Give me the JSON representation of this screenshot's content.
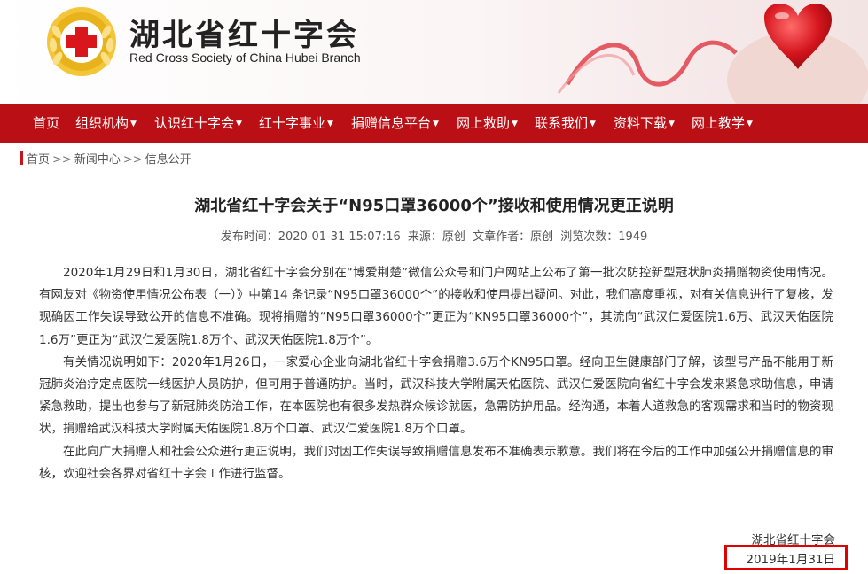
{
  "header": {
    "org_name_cn": "湖北省红十字会",
    "org_name_en": "Red Cross Society of China Hubei Branch",
    "colors": {
      "brand_red": "#b90f15",
      "emblem_gold": "#e8b21a",
      "cross_red": "#d9161c"
    }
  },
  "nav": {
    "items": [
      {
        "label": "首页",
        "dropdown": false
      },
      {
        "label": "组织机构",
        "dropdown": true
      },
      {
        "label": "认识红十字会",
        "dropdown": true
      },
      {
        "label": "红十字事业",
        "dropdown": true
      },
      {
        "label": "捐赠信息平台",
        "dropdown": true
      },
      {
        "label": "网上救助",
        "dropdown": true
      },
      {
        "label": "联系我们",
        "dropdown": true
      },
      {
        "label": "资料下载",
        "dropdown": true
      },
      {
        "label": "网上教学",
        "dropdown": true
      }
    ],
    "caret_icon": "caret-down-icon"
  },
  "breadcrumb": {
    "items": [
      "首页",
      "新闻中心",
      "信息公开"
    ],
    "separator": ">>"
  },
  "article": {
    "title": "湖北省红十字会关于“N95口罩36000个”接收和使用情况更正说明",
    "meta": {
      "publish_time": "发布时间：2020-01-31 15:07:16",
      "source": "来源：原创",
      "author": "文章作者：原创",
      "views": "浏览次数：1949"
    },
    "paragraphs": [
      "2020年1月29日和1月30日，湖北省红十字会分别在“博爱荆楚”微信公众号和门户网站上公布了第一批次防控新型冠状肺炎捐赠物资使用情况。有网友对《物资使用情况公布表（一）》中第14 条记录“N95口罩36000个”的接收和使用提出疑问。对此，我们高度重视，对有关信息进行了复核，发现确因工作失误导致公开的信息不准确。现将捐赠的“N95口罩36000个”更正为“KN95口罩36000个”，其流向“武汉仁爱医院1.6万、武汉天佑医院1.6万”更正为“武汉仁爱医院1.8万个、武汉天佑医院1.8万个”。",
      "有关情况说明如下：2020年1月26日，一家爱心企业向湖北省红十字会捐赠3.6万个KN95口罩。经向卫生健康部门了解，该型号产品不能用于新冠肺炎治疗定点医院一线医护人员防护，但可用于普通防护。当时，武汉科技大学附属天佑医院、武汉仁爱医院向省红十字会发来紧急求助信息，申请紧急救助，提出也参与了新冠肺炎防治工作，在本医院也有很多发热群众候诊就医，急需防护用品。经沟通，本着人道救急的客观需求和当时的物资现状，捐赠给武汉科技大学附属天佑医院1.8万个口罩、武汉仁爱医院1.8万个口罩。",
      "在此向广大捐赠人和社会公众进行更正说明，我们对因工作失误导致捐赠信息发布不准确表示歉意。我们将在今后的工作中加强公开捐赠信息的审核，欢迎社会各界对省红十字会工作进行监督。"
    ],
    "signature_org": "湖北省红十字会",
    "signature_date": "2019年1月31日",
    "highlight_color": "#e00000"
  }
}
